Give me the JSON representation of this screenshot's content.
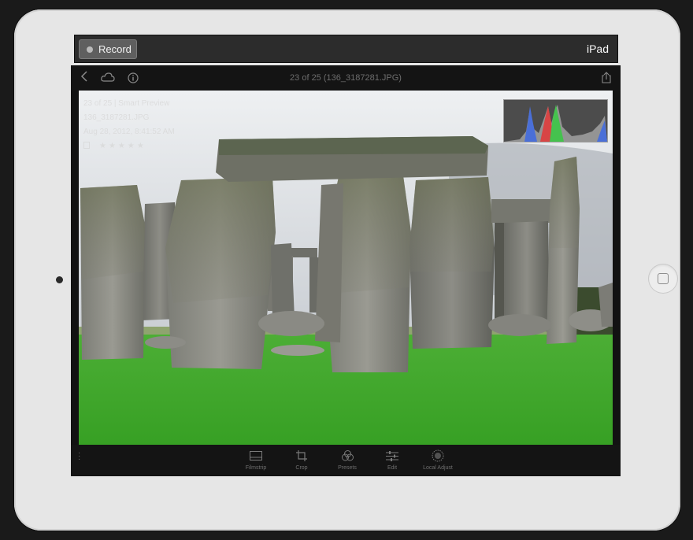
{
  "device": {
    "name": "iPad"
  },
  "recorder": {
    "record_label": "Record"
  },
  "app": {
    "title": "23 of 25 (136_3187281.JPG)",
    "icons": [
      "back-chevron-icon",
      "cloud-icon",
      "info-icon",
      "share-icon"
    ]
  },
  "photo_info": {
    "line1": "23 of 25 | Smart Preview",
    "line2": "136_3187281.JPG",
    "line3": "Aug 28, 2012, 8:41:52 AM",
    "stars": "★★★★★"
  },
  "toolbar": {
    "items": [
      {
        "label": "Filmstrip",
        "icon": "filmstrip-icon"
      },
      {
        "label": "Crop",
        "icon": "crop-icon"
      },
      {
        "label": "Presets",
        "icon": "presets-icon"
      },
      {
        "label": "Edit",
        "icon": "sliders-icon"
      },
      {
        "label": "Local Adjust",
        "icon": "local-adjust-icon"
      }
    ]
  },
  "colors": {
    "sky": "#e8e8ea",
    "grass": "#3fa52a",
    "stone": "#8a8a83",
    "ui_dark": "#141414"
  }
}
